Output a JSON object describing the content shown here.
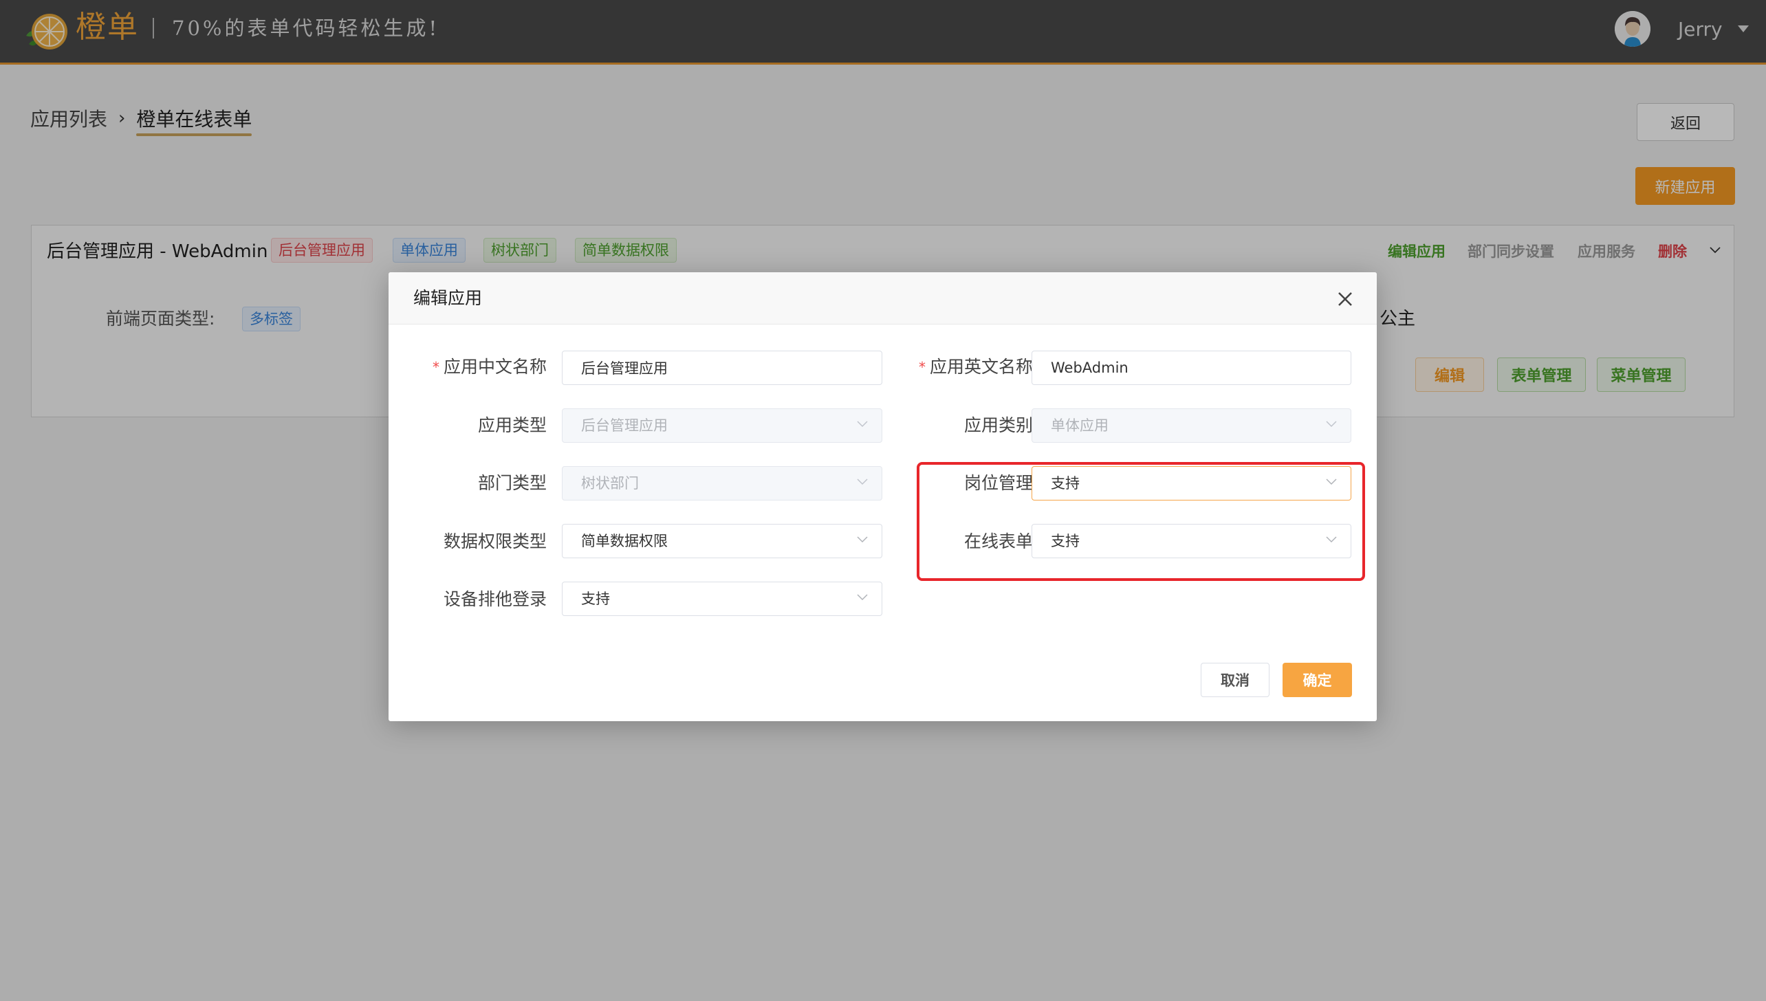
{
  "header": {
    "brand": "橙单",
    "slogan": "70%的表单代码轻松生成!",
    "user_name": "Jerry"
  },
  "breadcrumb": {
    "items": [
      "应用列表",
      "橙单在线表单"
    ]
  },
  "toolbar": {
    "back_label": "返回",
    "new_app_label": "新建应用"
  },
  "app_card": {
    "title": "后台管理应用 - WebAdmin",
    "tags": [
      "后台管理应用",
      "单体应用",
      "树状部门",
      "简单数据权限"
    ],
    "actions": {
      "edit": "编辑应用",
      "dept_sync": "部门同步设置",
      "app_service": "应用服务",
      "delete": "删除"
    },
    "frontend_label": "前端页面类型:",
    "frontend_value": "多标签",
    "partial_text": "公主",
    "buttons": {
      "edit": "编辑",
      "form_manage": "表单管理",
      "menu_manage": "菜单管理"
    }
  },
  "modal": {
    "title": "编辑应用",
    "fields": {
      "cn_name": {
        "label": "应用中文名称",
        "required": true,
        "value": "后台管理应用"
      },
      "en_name": {
        "label": "应用英文名称",
        "required": true,
        "value": "WebAdmin"
      },
      "app_type": {
        "label": "应用类型",
        "value": "后台管理应用",
        "disabled": true
      },
      "app_category": {
        "label": "应用类别",
        "value": "单体应用",
        "disabled": true
      },
      "dept_type": {
        "label": "部门类型",
        "value": "树状部门",
        "disabled": true
      },
      "post_manage": {
        "label": "岗位管理",
        "value": "支持",
        "focused": true
      },
      "data_perm_type": {
        "label": "数据权限类型",
        "value": "简单数据权限"
      },
      "online_form": {
        "label": "在线表单",
        "value": "支持"
      },
      "device_exclusive_login": {
        "label": "设备排他登录",
        "value": "支持"
      }
    },
    "required_mark": "*",
    "cancel_label": "取消",
    "ok_label": "确定"
  },
  "colors": {
    "accent": "#f59a23",
    "highlight_box": "#e8262b",
    "success": "#4ea12e",
    "danger": "#e0434a",
    "info": "#3a86dd"
  }
}
